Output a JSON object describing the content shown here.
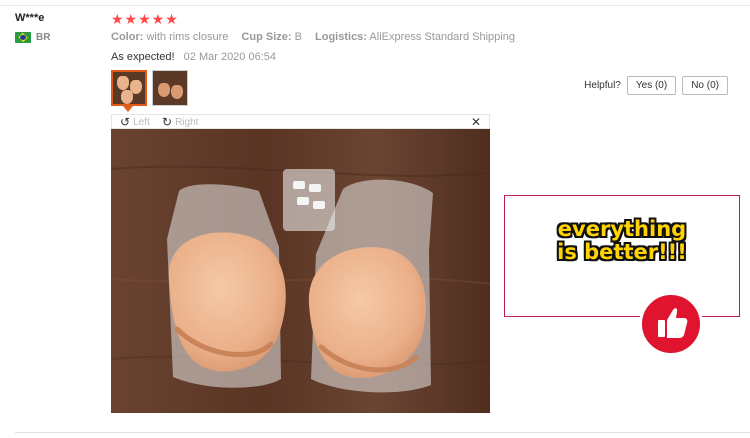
{
  "review": {
    "user": "W***e",
    "country": "BR",
    "stars": "★★★★★",
    "attributes": [
      {
        "label": "Color:",
        "value": "with rims closure"
      },
      {
        "label": "Cup Size:",
        "value": "B"
      },
      {
        "label": "Logistics:",
        "value": "AliExpress Standard Shipping"
      }
    ],
    "feedback": "As expected!",
    "date": "02 Mar 2020 06:54"
  },
  "helpful": {
    "label": "Helpful?",
    "yes": "Yes (0)",
    "no": "No (0)"
  },
  "viewer": {
    "left": "Left",
    "right": "Right",
    "close": "✕"
  },
  "overlay": {
    "line1": "everything",
    "line2": "is better!!!"
  },
  "colors": {
    "stars": "#ff4747",
    "active_thumb": "#e05a1a",
    "ad_border": "#c2185b",
    "ad_text": "#ffd400",
    "badge": "#e0142e"
  },
  "icons": [
    "flag-icon",
    "rotate-left-icon",
    "rotate-right-icon",
    "close-icon",
    "thumbs-up-icon"
  ]
}
